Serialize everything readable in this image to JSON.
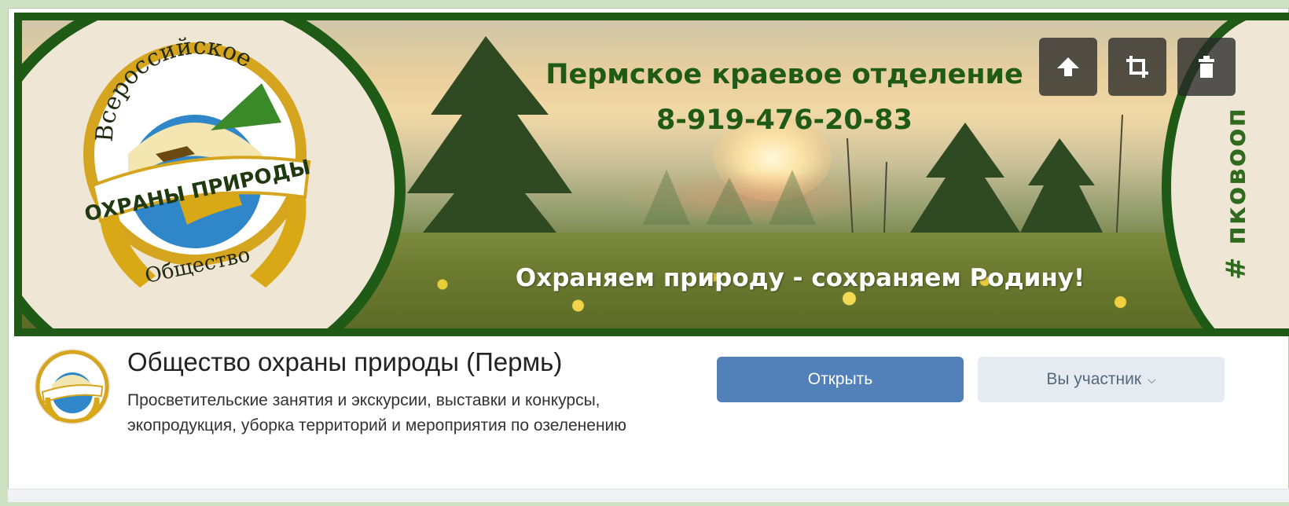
{
  "cover": {
    "title_line1": "Пермское краевое отделение",
    "title_line2": "8-919-476-20-83",
    "slogan": "Охраняем природу - сохраняем Родину!",
    "side_tag": "# пковооп",
    "logo": {
      "top_text": "Всероссийское",
      "ribbon_text": "ОХРАНЫ ПРИРОДЫ",
      "bottom_text": "Общество"
    },
    "tools": [
      "upload-icon",
      "crop-icon",
      "trash-icon"
    ]
  },
  "group": {
    "name": "Общество охраны природы (Пермь)",
    "description": "Просветительские занятия и экскурсии, выставки и конкурсы, экопродукция, уборка территорий и мероприятия по озеленению"
  },
  "actions": {
    "open_label": "Открыть",
    "member_label": "Вы участник",
    "member_chevron": "⌵"
  },
  "colors": {
    "brand_green": "#1f5a17",
    "primary_button": "#5181b8",
    "secondary_button": "#e5ebf1"
  }
}
